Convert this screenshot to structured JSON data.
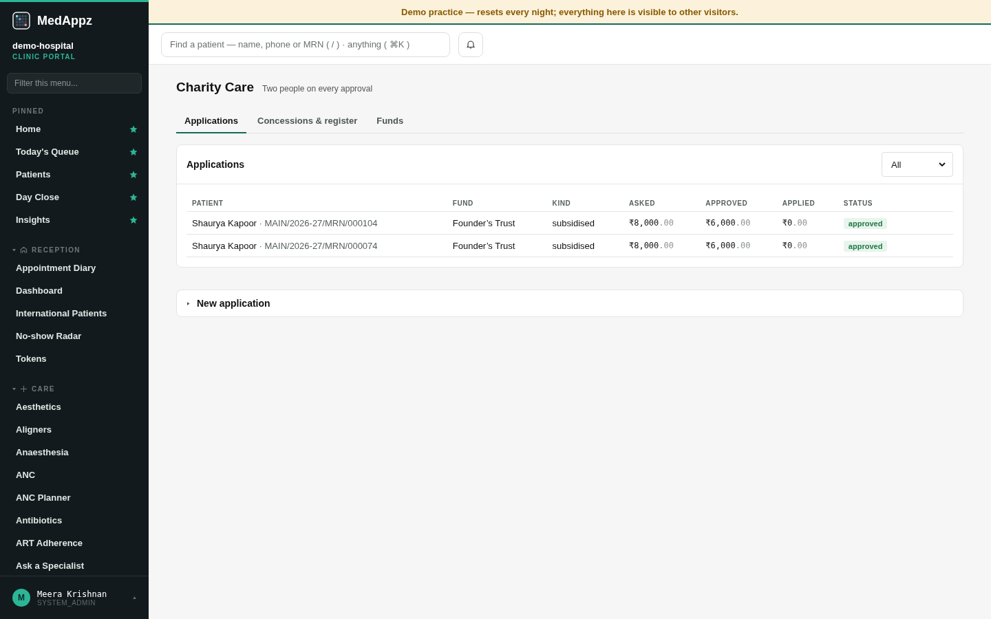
{
  "sidebar": {
    "brand": "MedAppz",
    "org": "demo-hospital",
    "portal": "CLINIC PORTAL",
    "filter_placeholder": "Filter this menu...",
    "pinned_label": "PINNED",
    "pinned": [
      {
        "label": "Home"
      },
      {
        "label": "Today's Queue"
      },
      {
        "label": "Patients"
      },
      {
        "label": "Day Close"
      },
      {
        "label": "Insights"
      }
    ],
    "sections": [
      {
        "label": "RECEPTION",
        "kind": "reception",
        "expanded": true,
        "items": [
          {
            "label": "Appointment Diary"
          },
          {
            "label": "Dashboard"
          },
          {
            "label": "International Patients"
          },
          {
            "label": "No-show Radar"
          },
          {
            "label": "Tokens"
          }
        ]
      },
      {
        "label": "CARE",
        "kind": "care",
        "expanded": true,
        "items": [
          {
            "label": "Aesthetics"
          },
          {
            "label": "Aligners"
          },
          {
            "label": "Anaesthesia"
          },
          {
            "label": "ANC"
          },
          {
            "label": "ANC Planner"
          },
          {
            "label": "Antibiotics"
          },
          {
            "label": "ART Adherence"
          },
          {
            "label": "Ask a Specialist"
          }
        ]
      }
    ],
    "user": {
      "initial": "M",
      "name": "Meera Krishnan",
      "role": "SYSTEM_ADMIN"
    }
  },
  "banner": "Demo practice — resets every night; everything here is visible to other visitors.",
  "search": {
    "placeholder": "Find a patient — name, phone or MRN ( / ) · anything ( ⌘K )"
  },
  "page": {
    "title": "Charity Care",
    "subtitle": "Two people on every approval",
    "tabs": [
      {
        "label": "Applications",
        "selected": true
      },
      {
        "label": "Concessions & register",
        "selected": false
      },
      {
        "label": "Funds",
        "selected": false
      }
    ],
    "card": {
      "title": "Applications",
      "filter": "All",
      "columns": [
        "PATIENT",
        "FUND",
        "KIND",
        "ASKED",
        "APPROVED",
        "APPLIED",
        "STATUS"
      ],
      "rows": [
        {
          "name": "Shaurya Kapoor",
          "mrn": "· MAIN/2026-27/MRN/000104",
          "fund": "Founder’s Trust",
          "kind": "subsidised",
          "asked": {
            "whole": "₹8,000",
            "cents": ".00"
          },
          "approved": {
            "whole": "₹6,000",
            "cents": ".00"
          },
          "applied": {
            "whole": "₹0",
            "cents": ".00"
          },
          "status": "approved",
          "color": "#1e7a45"
        },
        {
          "name": "Shaurya Kapoor",
          "mrn": "· MAIN/2026-27/MRN/000074",
          "fund": "Founder’s Trust",
          "kind": "subsidised",
          "asked": {
            "whole": "₹8,000",
            "cents": ".00"
          },
          "approved": {
            "whole": "₹6,000",
            "cents": ".00"
          },
          "applied": {
            "whole": "₹0",
            "cents": ".00"
          },
          "status": "approved",
          "color": "#1e7a45"
        }
      ]
    },
    "new_application": {
      "label": "New application",
      "expanded": false
    }
  }
}
